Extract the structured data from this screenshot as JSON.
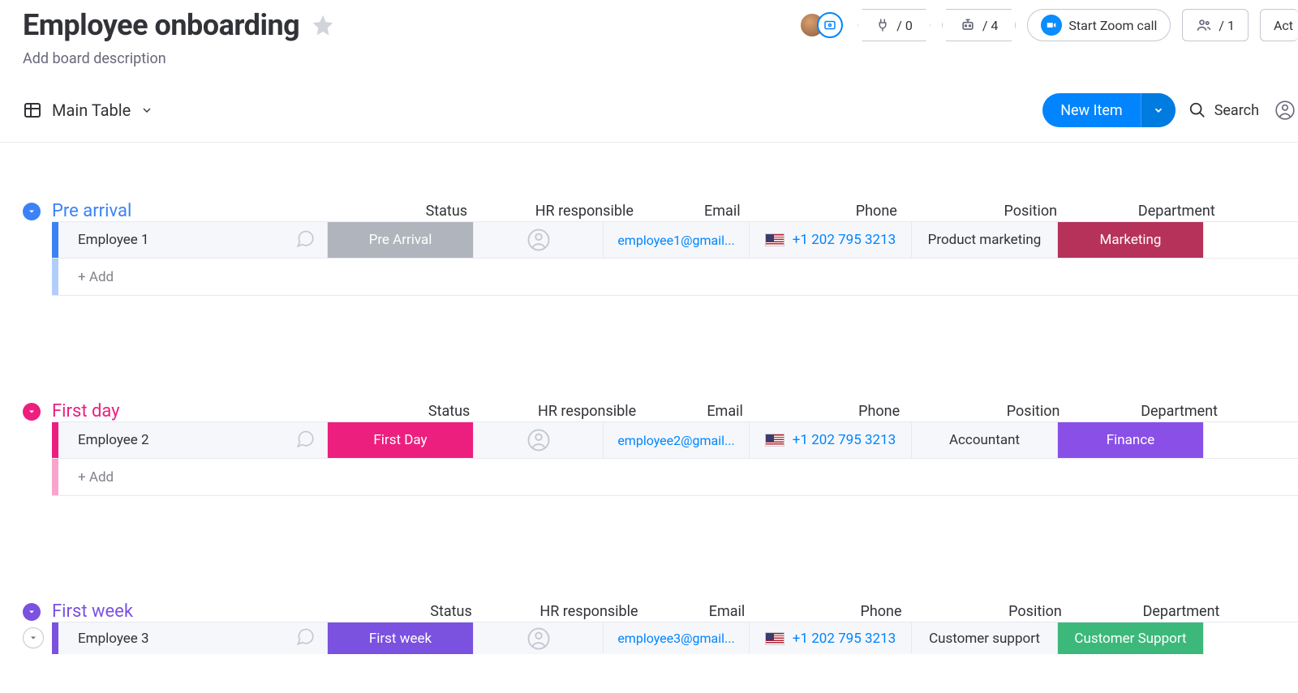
{
  "header": {
    "title": "Employee onboarding",
    "description": "Add board description",
    "integrations_count": "0",
    "automations_count": "4",
    "zoom_label": "Start Zoom call",
    "members_count": "1",
    "activity_label": "Act"
  },
  "view": {
    "current": "Main Table",
    "new_item_label": "New Item",
    "search_label": "Search"
  },
  "columns": {
    "status": "Status",
    "hr": "HR responsible",
    "email": "Email",
    "phone": "Phone",
    "position": "Position",
    "department": "Department"
  },
  "add_label": "+ Add",
  "groups": [
    {
      "name": "Pre arrival",
      "color": "#3b82f6",
      "rows": [
        {
          "name": "Employee 1",
          "status": {
            "label": "Pre Arrival",
            "bg": "#b0b5bd"
          },
          "email": "employee1@gmail...",
          "phone": "+1 202 795 3213",
          "position": "Product marketing",
          "department": {
            "label": "Marketing",
            "bg": "#b6325a"
          }
        }
      ]
    },
    {
      "name": "First day",
      "color": "#ec1f7f",
      "rows": [
        {
          "name": "Employee 2",
          "status": {
            "label": "First Day",
            "bg": "#ec1f7f"
          },
          "email": "employee2@gmail...",
          "phone": "+1 202 795 3213",
          "position": "Accountant",
          "department": {
            "label": "Finance",
            "bg": "#8a4fe7"
          }
        }
      ]
    },
    {
      "name": "First week",
      "color": "#7b51e0",
      "rows": [
        {
          "name": "Employee 3",
          "status": {
            "label": "First week",
            "bg": "#7b51e0"
          },
          "email": "employee3@gmail...",
          "phone": "+1 202 795 3213",
          "position": "Customer support",
          "department": {
            "label": "Customer Support",
            "bg": "#3cb97a"
          }
        }
      ]
    }
  ]
}
